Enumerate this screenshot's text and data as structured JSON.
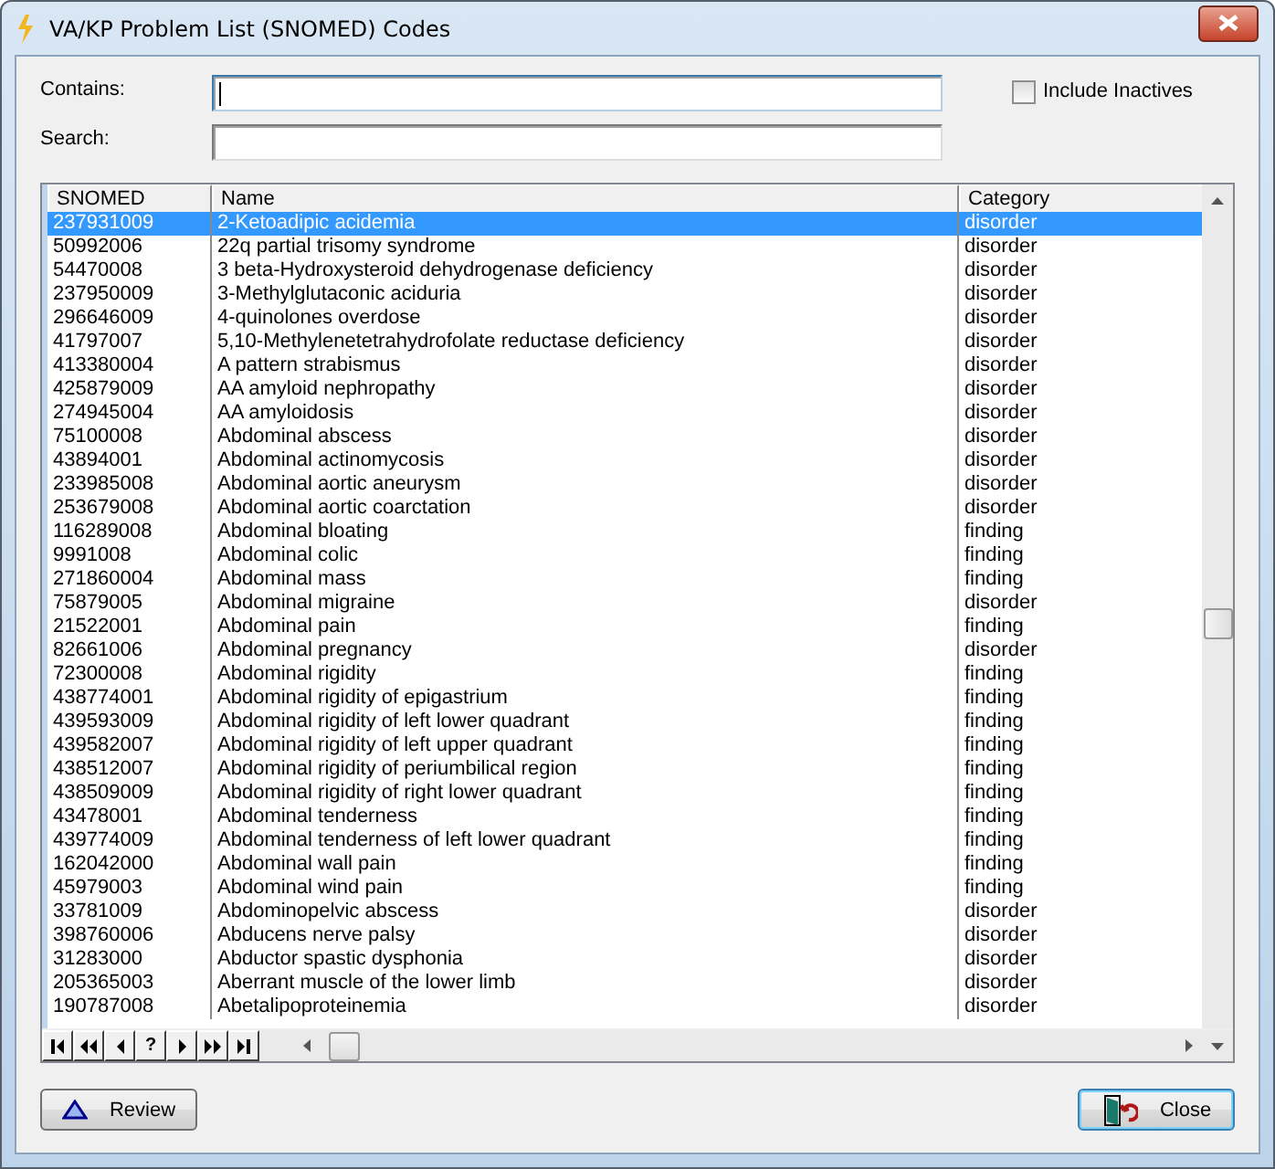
{
  "window": {
    "title": "VA/KP Problem List (SNOMED) Codes"
  },
  "fields": [
    {
      "label": "Contains:",
      "focused": true
    },
    {
      "label": "Search:",
      "focused": false
    }
  ],
  "include_inactives": {
    "label": "Include Inactives",
    "checked": false
  },
  "table": {
    "columns": [
      "SNOMED",
      "Name",
      "Category"
    ],
    "rows": [
      {
        "code": "237931009",
        "name": "2-Ketoadipic acidemia",
        "category": "disorder",
        "selected": true
      },
      {
        "code": "50992006",
        "name": "22q partial trisomy syndrome",
        "category": "disorder",
        "selected": false
      },
      {
        "code": "54470008",
        "name": "3 beta-Hydroxysteroid dehydrogenase deficiency",
        "category": "disorder",
        "selected": false
      },
      {
        "code": "237950009",
        "name": "3-Methylglutaconic aciduria",
        "category": "disorder",
        "selected": false
      },
      {
        "code": "296646009",
        "name": "4-quinolones overdose",
        "category": "disorder",
        "selected": false
      },
      {
        "code": "41797007",
        "name": "5,10-Methylenetetrahydrofolate reductase deficiency",
        "category": "disorder",
        "selected": false
      },
      {
        "code": "413380004",
        "name": "A pattern strabismus",
        "category": "disorder",
        "selected": false
      },
      {
        "code": "425879009",
        "name": "AA amyloid nephropathy",
        "category": "disorder",
        "selected": false
      },
      {
        "code": "274945004",
        "name": "AA amyloidosis",
        "category": "disorder",
        "selected": false
      },
      {
        "code": "75100008",
        "name": "Abdominal abscess",
        "category": "disorder",
        "selected": false
      },
      {
        "code": "43894001",
        "name": "Abdominal actinomycosis",
        "category": "disorder",
        "selected": false
      },
      {
        "code": "233985008",
        "name": "Abdominal aortic aneurysm",
        "category": "disorder",
        "selected": false
      },
      {
        "code": "253679008",
        "name": "Abdominal aortic coarctation",
        "category": "disorder",
        "selected": false
      },
      {
        "code": "116289008",
        "name": "Abdominal bloating",
        "category": "finding",
        "selected": false
      },
      {
        "code": "9991008",
        "name": "Abdominal colic",
        "category": "finding",
        "selected": false
      },
      {
        "code": "271860004",
        "name": "Abdominal mass",
        "category": "finding",
        "selected": false
      },
      {
        "code": "75879005",
        "name": "Abdominal migraine",
        "category": "disorder",
        "selected": false
      },
      {
        "code": "21522001",
        "name": "Abdominal pain",
        "category": "finding",
        "selected": false
      },
      {
        "code": "82661006",
        "name": "Abdominal pregnancy",
        "category": "disorder",
        "selected": false
      },
      {
        "code": "72300008",
        "name": "Abdominal rigidity",
        "category": "finding",
        "selected": false
      },
      {
        "code": "438774001",
        "name": "Abdominal rigidity of epigastrium",
        "category": "finding",
        "selected": false
      },
      {
        "code": "439593009",
        "name": "Abdominal rigidity of left lower quadrant",
        "category": "finding",
        "selected": false
      },
      {
        "code": "439582007",
        "name": "Abdominal rigidity of left upper quadrant",
        "category": "finding",
        "selected": false
      },
      {
        "code": "438512007",
        "name": "Abdominal rigidity of periumbilical region",
        "category": "finding",
        "selected": false
      },
      {
        "code": "438509009",
        "name": "Abdominal rigidity of right lower quadrant",
        "category": "finding",
        "selected": false
      },
      {
        "code": "43478001",
        "name": "Abdominal tenderness",
        "category": "finding",
        "selected": false
      },
      {
        "code": "439774009",
        "name": "Abdominal tenderness of left lower quadrant",
        "category": "finding",
        "selected": false
      },
      {
        "code": "162042000",
        "name": "Abdominal wall pain",
        "category": "finding",
        "selected": false
      },
      {
        "code": "45979003",
        "name": "Abdominal wind pain",
        "category": "finding",
        "selected": false
      },
      {
        "code": "33781009",
        "name": "Abdominopelvic abscess",
        "category": "disorder",
        "selected": false
      },
      {
        "code": "398760006",
        "name": "Abducens nerve palsy",
        "category": "disorder",
        "selected": false
      },
      {
        "code": "31283000",
        "name": "Abductor spastic dysphonia",
        "category": "disorder",
        "selected": false
      },
      {
        "code": "205365003",
        "name": "Aberrant muscle of the lower limb",
        "category": "disorder",
        "selected": false
      },
      {
        "code": "190787008",
        "name": "Abetalipoproteinemia",
        "category": "disorder",
        "selected": false
      }
    ]
  },
  "navigator": [
    {
      "kind": "first"
    },
    {
      "kind": "prior-page"
    },
    {
      "kind": "prior"
    },
    {
      "kind": "help",
      "label": "?"
    },
    {
      "kind": "next"
    },
    {
      "kind": "next-page"
    },
    {
      "kind": "last"
    }
  ],
  "buttons": [
    {
      "kind": "review",
      "label": "Review",
      "default": false
    },
    {
      "kind": "close",
      "label": "Close",
      "default": true
    }
  ]
}
